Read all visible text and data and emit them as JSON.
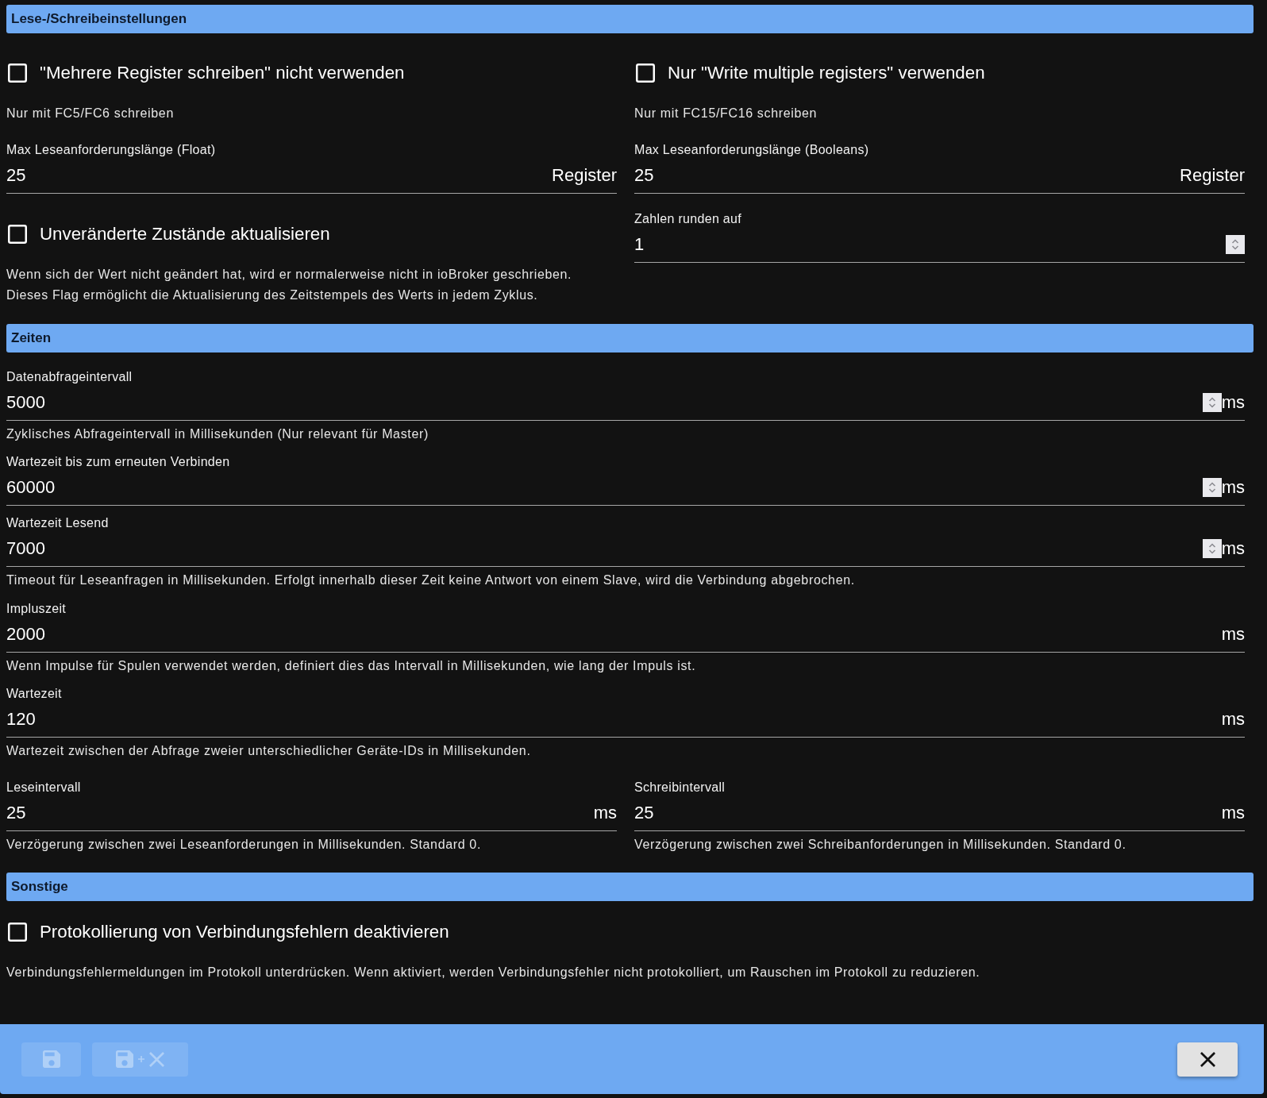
{
  "sections": [
    {
      "title": "Lese-/Schreibeinstellungen",
      "rows": [
        {
          "items": [
            {
              "kind": "checkbox",
              "label": "\"Mehrere Register schreiben\" nicht verwenden",
              "checked": false,
              "help": "Nur mit FC5/FC6 schreiben"
            },
            {
              "kind": "checkbox",
              "label": "Nur \"Write multiple registers\" verwenden",
              "checked": false,
              "help": "Nur mit FC15/FC16 schreiben"
            }
          ]
        },
        {
          "items": [
            {
              "kind": "number",
              "label": "Max Leseanforderungslänge (Float)",
              "value": "25",
              "unit": "Register",
              "spinner": false
            },
            {
              "kind": "number",
              "label": "Max Leseanforderungslänge (Booleans)",
              "value": "25",
              "unit": "Register",
              "spinner": false
            }
          ]
        },
        {
          "items": [
            {
              "kind": "checkbox",
              "label": "Unveränderte Zustände aktualisieren",
              "checked": false,
              "help": "Wenn sich der Wert nicht geändert hat, wird er normalerweise nicht in ioBroker geschrieben.\nDieses Flag ermöglicht die Aktualisierung des Zeitstempels des Werts in jedem Zyklus."
            },
            {
              "kind": "number",
              "label": "Zahlen runden auf",
              "value": "1",
              "spinner": true
            }
          ]
        }
      ]
    },
    {
      "title": "Zeiten",
      "rows": [
        {
          "items": [
            {
              "kind": "number",
              "label": "Datenabfrageintervall",
              "value": "5000",
              "unit": "ms",
              "spinner": true,
              "help": "Zyklisches Abfrageintervall in Millisekunden (Nur relevant für Master)"
            }
          ]
        },
        {
          "items": [
            {
              "kind": "number",
              "label": "Wartezeit bis zum erneuten Verbinden",
              "value": "60000",
              "unit": "ms",
              "spinner": true
            }
          ]
        },
        {
          "items": [
            {
              "kind": "number",
              "label": "Wartezeit Lesend",
              "value": "7000",
              "unit": "ms",
              "spinner": true,
              "help": "Timeout für Leseanfragen in Millisekunden. Erfolgt innerhalb dieser Zeit keine Antwort von einem Slave, wird die Verbindung abgebrochen."
            }
          ]
        },
        {
          "items": [
            {
              "kind": "number",
              "label": "Impluszeit",
              "value": "2000",
              "unit": "ms",
              "spinner": false,
              "help": "Wenn Impulse für Spulen verwendet werden, definiert dies das Intervall in Millisekunden, wie lang der Impuls ist."
            }
          ]
        },
        {
          "items": [
            {
              "kind": "number",
              "label": "Wartezeit",
              "value": "120",
              "unit": "ms",
              "spinner": false,
              "help": "Wartezeit zwischen der Abfrage zweier unterschiedlicher Geräte-IDs in Millisekunden."
            }
          ]
        },
        {
          "items": [
            {
              "kind": "number",
              "label": "Leseintervall",
              "value": "25",
              "unit": "ms",
              "spinner": false,
              "help": "Verzögerung zwischen zwei Leseanforderungen in Millisekunden. Standard 0."
            },
            {
              "kind": "number",
              "label": "Schreibintervall",
              "value": "25",
              "unit": "ms",
              "spinner": false,
              "help": "Verzögerung zwischen zwei Schreibanforderungen in Millisekunden. Standard 0."
            }
          ]
        }
      ]
    },
    {
      "title": "Sonstige",
      "rows": [
        {
          "items": [
            {
              "kind": "checkbox",
              "label": "Protokollierung von Verbindungsfehlern deaktivieren",
              "checked": false,
              "help": "Verbindungsfehlermeldungen im Protokoll unterdrücken. Wenn aktiviert, werden Verbindungsfehler nicht protokolliert, um Rauschen im Protokoll zu reduzieren."
            }
          ]
        }
      ]
    }
  ],
  "footer": {
    "buttons": [
      {
        "kind": "save",
        "disabled": true
      },
      {
        "kind": "save_close",
        "disabled": true
      },
      {
        "kind": "close",
        "disabled": false
      }
    ]
  }
}
